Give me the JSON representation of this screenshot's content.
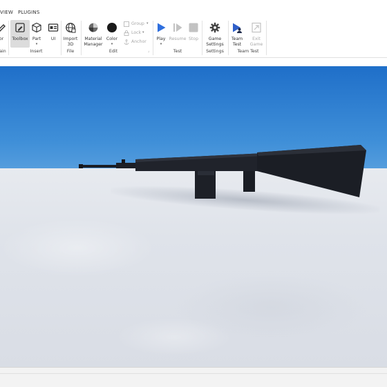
{
  "tabs": {
    "view": "VIEW",
    "plugins": "PLUGINS"
  },
  "ribbon": {
    "tools": {
      "editor": "or",
      "toolbox": "Toolbox",
      "part": "Part",
      "ui": "UI",
      "import3d_line1": "Import",
      "import3d_line2": "3D",
      "material_line1": "Material",
      "material_line2": "Manager",
      "color": "Color",
      "play": "Play",
      "resume": "Resume",
      "stop": "Stop",
      "game_settings_line1": "Game",
      "game_settings_line2": "Settings",
      "team_test_line1": "Team",
      "team_test_line2": "Test",
      "exit_game_line1": "Exit",
      "exit_game_line2": "Game"
    },
    "small_tools": {
      "group": "Group",
      "lock": "Lock",
      "anchor": "Anchor"
    },
    "group_labels": {
      "left": "ain",
      "insert": "Insert",
      "file": "File",
      "edit": "Edit",
      "test": "Test",
      "settings": "Settings",
      "team_test": "Team Test"
    }
  },
  "colors": {
    "play_blue": "#2f6fde",
    "sky_top": "#1f6fc9",
    "baseplate": "#dfe3ea",
    "rifle": "#1a1d24"
  },
  "icons": {
    "editor": "editor-icon",
    "toolbox": "toolbox-icon",
    "part": "cube-icon",
    "ui": "ui-icon",
    "import3d": "globe-icon",
    "material": "material-icon",
    "color": "color-icon",
    "play": "play-icon",
    "resume": "resume-icon",
    "stop": "stop-icon",
    "game_settings": "gear-icon",
    "team_test": "team-test-icon",
    "exit_game": "exit-game-icon"
  }
}
